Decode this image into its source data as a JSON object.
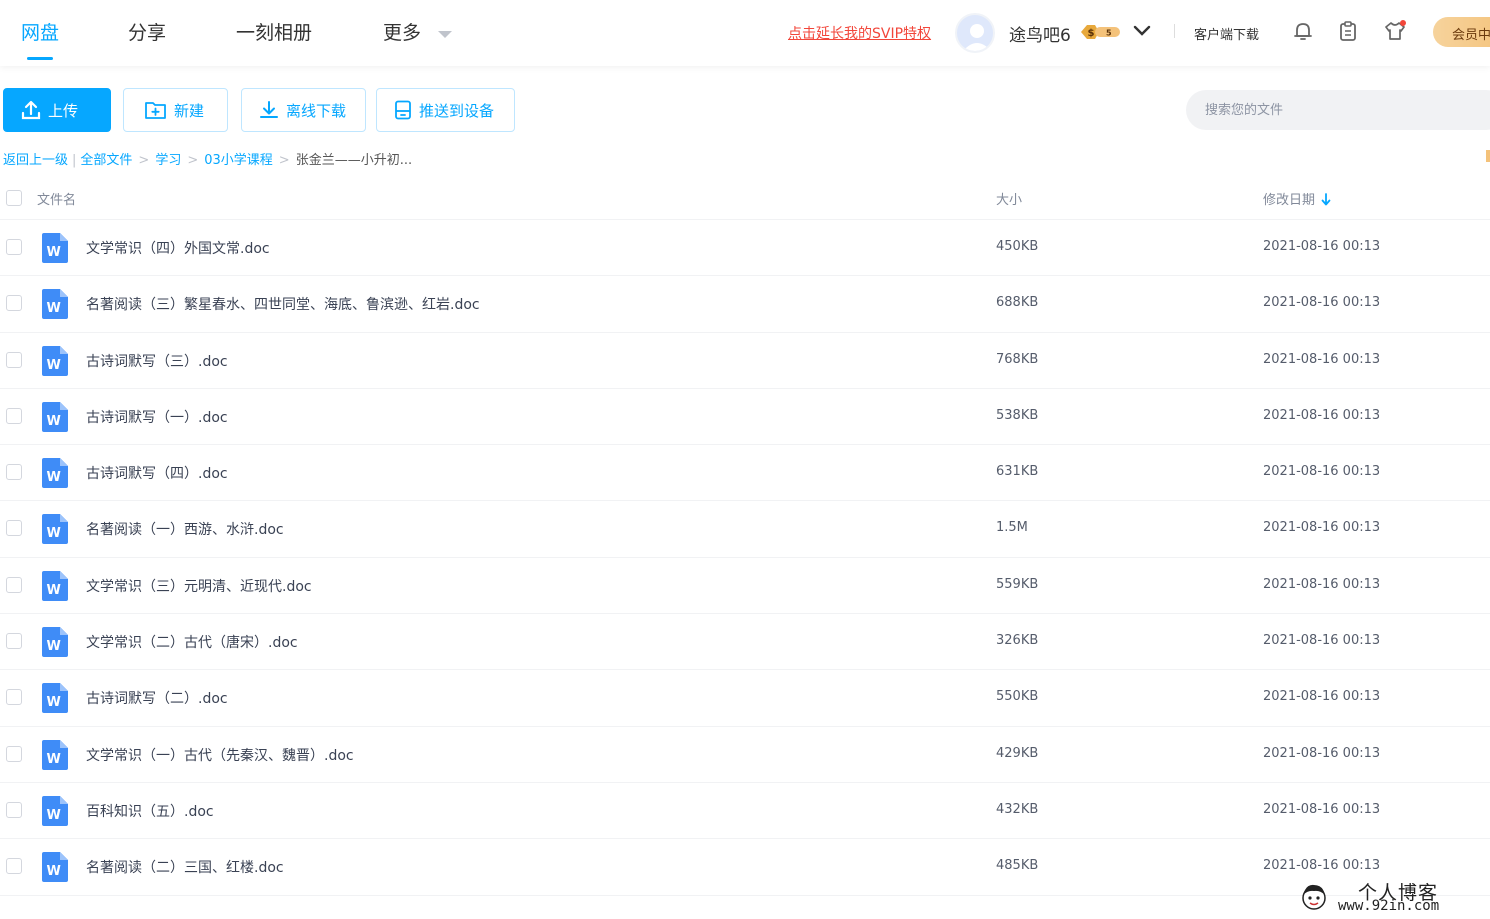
{
  "nav": {
    "tabs": [
      {
        "label": "网盘",
        "active": true
      },
      {
        "label": "分享"
      },
      {
        "label": "一刻相册"
      },
      {
        "label": "更多"
      }
    ]
  },
  "header": {
    "svip_link": "点击延长我的SVIP特权",
    "username": "途鸟吧6",
    "client_download": "客户端下载",
    "member_center": "会员中"
  },
  "toolbar": {
    "upload": "上传",
    "new": "新建",
    "offline_download": "离线下载",
    "push_device": "推送到设备",
    "search_placeholder": "搜索您的文件"
  },
  "breadcrumb": {
    "back": "返回上一级",
    "items": [
      "全部文件",
      "学习",
      "03小学课程"
    ],
    "current": "张金兰——小升初..."
  },
  "table": {
    "col_name": "文件名",
    "col_size": "大小",
    "col_date": "修改日期",
    "rows": [
      {
        "name": "文学常识（四）外国文常.doc",
        "size": "450KB",
        "date": "2021-08-16 00:13"
      },
      {
        "name": "名著阅读（三）繁星春水、四世同堂、海底、鲁滨逊、红岩.doc",
        "size": "688KB",
        "date": "2021-08-16 00:13"
      },
      {
        "name": "古诗词默写（三）.doc",
        "size": "768KB",
        "date": "2021-08-16 00:13"
      },
      {
        "name": "古诗词默写（一）.doc",
        "size": "538KB",
        "date": "2021-08-16 00:13"
      },
      {
        "name": "古诗词默写（四）.doc",
        "size": "631KB",
        "date": "2021-08-16 00:13"
      },
      {
        "name": "名著阅读（一）西游、水浒.doc",
        "size": "1.5M",
        "date": "2021-08-16 00:13"
      },
      {
        "name": "文学常识（三）元明清、近现代.doc",
        "size": "559KB",
        "date": "2021-08-16 00:13"
      },
      {
        "name": "文学常识（二）古代（唐宋）.doc",
        "size": "326KB",
        "date": "2021-08-16 00:13"
      },
      {
        "name": "古诗词默写（二）.doc",
        "size": "550KB",
        "date": "2021-08-16 00:13"
      },
      {
        "name": "文学常识（一）古代（先秦汉、魏晋）.doc",
        "size": "429KB",
        "date": "2021-08-16 00:13"
      },
      {
        "name": "百科知识（五）.doc",
        "size": "432KB",
        "date": "2021-08-16 00:13"
      },
      {
        "name": "名著阅读（二）三国、红楼.doc",
        "size": "485KB",
        "date": "2021-08-16 00:13"
      }
    ]
  },
  "watermark": {
    "line1": "个人博客",
    "line2": "www.92in.com"
  },
  "colors": {
    "accent": "#06a7ff",
    "svip_red": "#f2463a",
    "member_gold": "#f4c27a"
  }
}
